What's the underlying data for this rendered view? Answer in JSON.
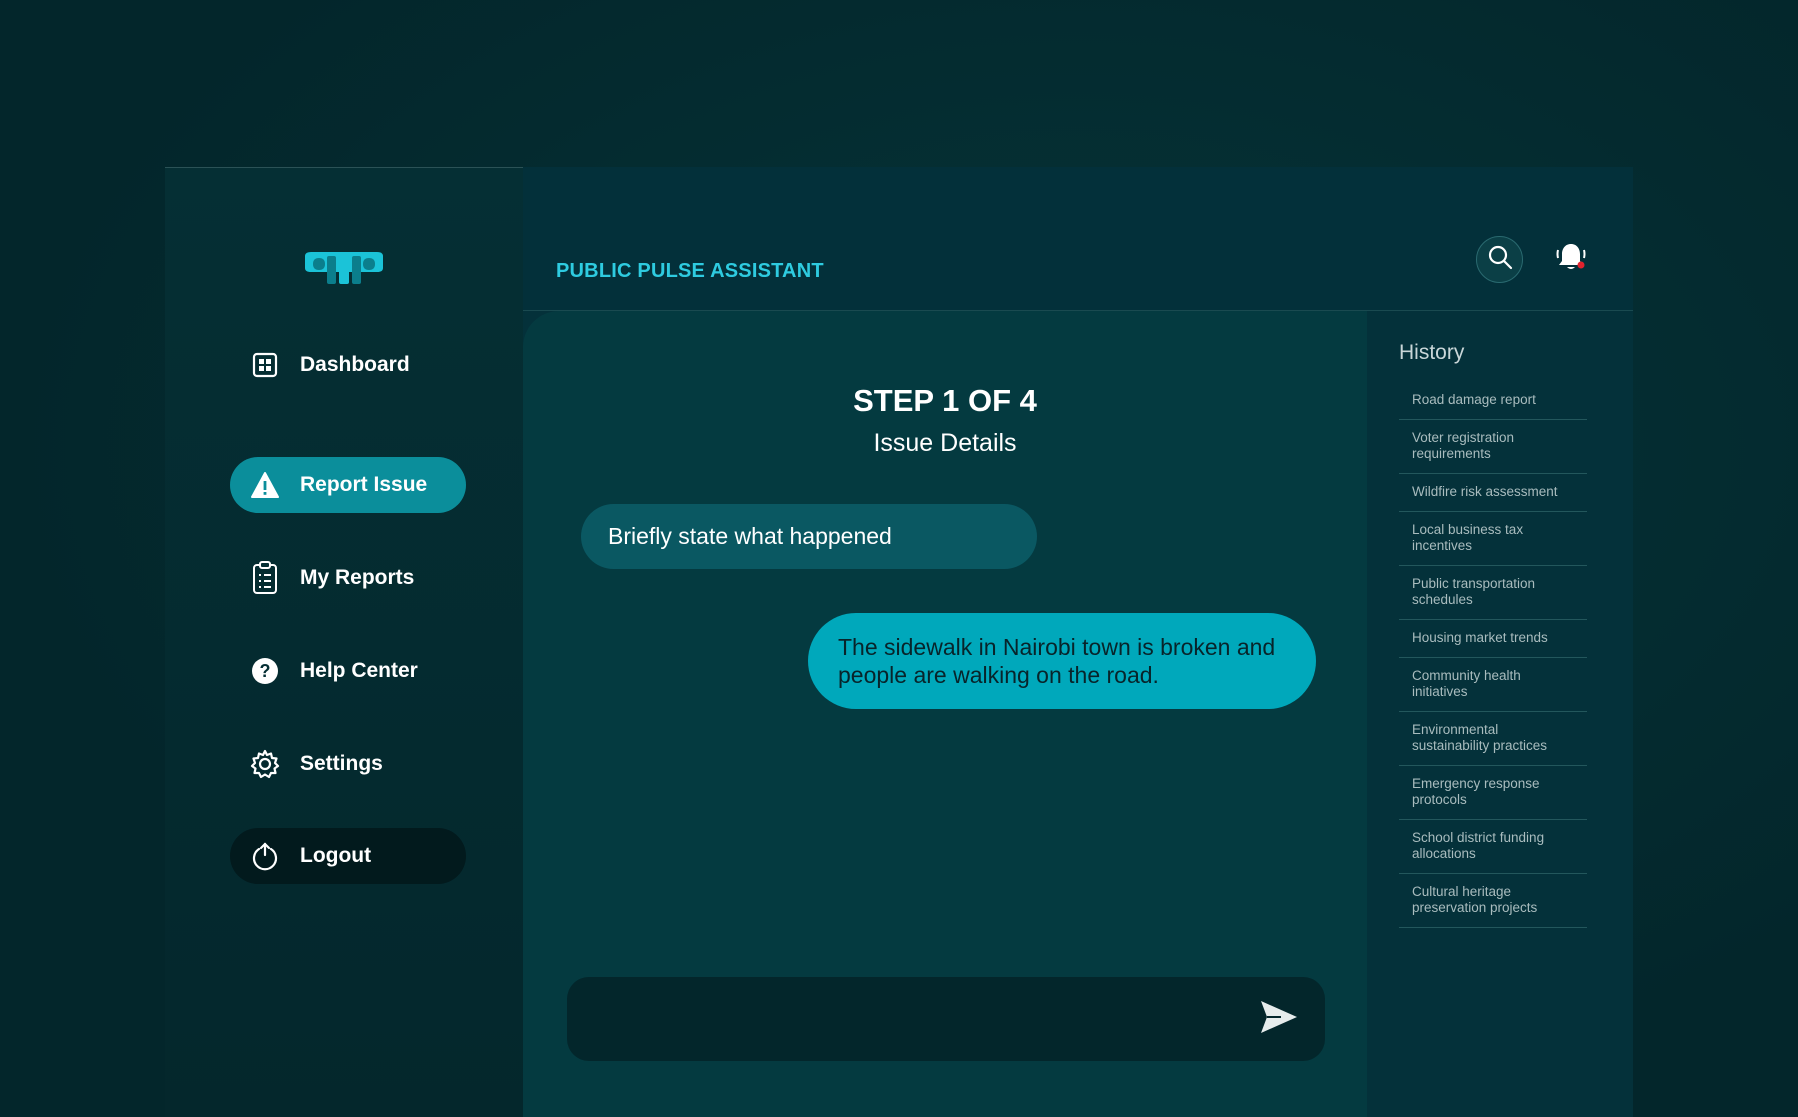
{
  "brand": {
    "app_title": "PUBLIC PULSE ASSISTANT"
  },
  "sidebar": {
    "items": [
      {
        "label": "Dashboard",
        "icon": "dashboard-grid-icon"
      },
      {
        "label": "Report Issue",
        "icon": "warning-icon",
        "active": true
      },
      {
        "label": "My Reports",
        "icon": "clipboard-icon"
      },
      {
        "label": "Help Center",
        "icon": "help-icon"
      },
      {
        "label": "Settings",
        "icon": "gear-icon"
      },
      {
        "label": "Logout",
        "icon": "power-icon"
      }
    ]
  },
  "header": {
    "search_icon": "search-icon",
    "bell_icon": "bell-icon"
  },
  "chat": {
    "step_title": "STEP 1 OF 4",
    "step_subtitle": "Issue Details",
    "bot_message": "Briefly state what happened",
    "user_message": "The sidewalk in Nairobi town is broken and people are walking on the road.",
    "input_value": "",
    "input_placeholder": "",
    "send_icon": "send-icon"
  },
  "history": {
    "title": "History",
    "items": [
      "Road damage report",
      "Voter registration requirements",
      "Wildfire risk assessment",
      "Local business tax incentives",
      "Public transportation schedules",
      "Housing market trends",
      "Community health initiatives",
      "Environmental sustainability practices",
      "Emergency response protocols",
      "School district funding allocations",
      "Cultural heritage preservation projects"
    ]
  },
  "colors": {
    "accent": "#2ecbe0",
    "active_nav": "#0b8e9b",
    "user_bubble": "#00a8bb",
    "bot_bubble": "#0a5862",
    "notification_dot": "#e0232e"
  }
}
